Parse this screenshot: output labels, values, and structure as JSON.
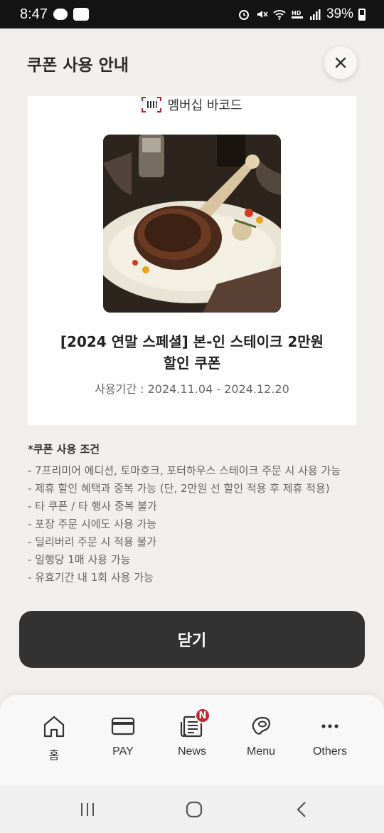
{
  "status_bar": {
    "time": "8:47",
    "battery": "39%"
  },
  "header": {
    "title": "쿠폰 사용 안내"
  },
  "coupon": {
    "barcode_label": "멤버십 바코드",
    "image_icon": "steak-photo",
    "title_line1": "[2024 연말 스페셜] 본-인 스테이크 2만원",
    "title_line2": "할인 쿠폰",
    "period": "사용기간 : 2024.11.04 - 2024.12.20"
  },
  "conditions": {
    "title": "*쿠폰 사용 조건",
    "items": [
      "- 7프리미어 에디션, 토마호크, 포터하우스 스테이크 주문 시 사용 가능",
      "- 제휴 할인 혜택과 중복 가능 (단, 2만원 선 할인 적용 후 제휴 적용)",
      "- 타 쿠폰 / 타 행사 중복 불가",
      "- 포장 주문 시에도 사용 가능",
      "- 딜리버리 주문 시 적용 불가",
      "- 일행당 1매 사용 가능",
      "- 유효기간 내 1회 사용 가능"
    ]
  },
  "confirm_button": {
    "label": "닫기"
  },
  "bottom_nav": {
    "items": [
      {
        "label": "홈",
        "icon": "home-icon"
      },
      {
        "label": "PAY",
        "icon": "card-icon"
      },
      {
        "label": "News",
        "icon": "news-icon",
        "badge": "N"
      },
      {
        "label": "Menu",
        "icon": "steak-icon"
      },
      {
        "label": "Others",
        "icon": "more-icon"
      }
    ]
  },
  "colors": {
    "primary_button": "#333232",
    "badge": "#c0272d",
    "background": "#f0efee"
  }
}
